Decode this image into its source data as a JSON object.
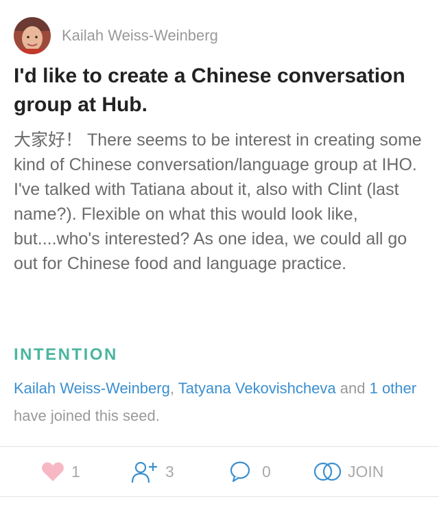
{
  "author": {
    "name": "Kailah Weiss-Weinberg"
  },
  "post": {
    "title": "I'd like to create a Chinese conversation group at Hub.",
    "body": "大家好！ There seems to be interest in creating some kind of Chinese conversation/language group at IHO. I've talked with Tatiana about it, also with Clint (last name?). Flexible on what this would look like, but....who's interested? As one idea, we could all go out for Chinese food and language practice."
  },
  "section": {
    "label": "INTENTION"
  },
  "joined": {
    "person1": "Kailah Weiss-Weinberg",
    "comma": ",",
    "person2": "Tatyana Vekovishcheva",
    "and": "and",
    "others": "1 other",
    "suffix": "have joined this seed."
  },
  "actions": {
    "likes": "1",
    "members": "3",
    "comments": "0",
    "join_label": "JOIN"
  },
  "colors": {
    "accent_teal": "#4bb5a0",
    "link_blue": "#3a8fd0",
    "heart_pink": "#f7b8c4",
    "muted_gray": "#a9a9a9"
  }
}
